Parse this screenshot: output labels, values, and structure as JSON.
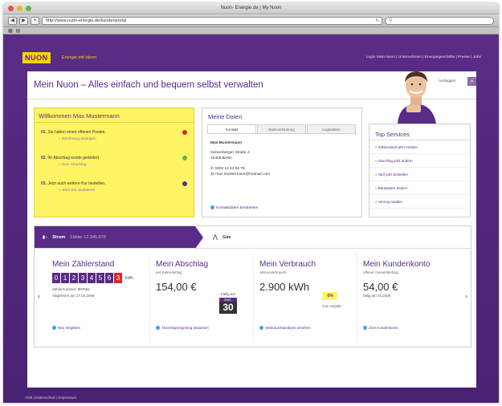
{
  "browser": {
    "window_title": "Nuon- Energie.de | My Nuon",
    "url": "http://www.nuon-energie.de/kundenportal",
    "search_placeholder": ""
  },
  "site": {
    "logo_text": "NUON",
    "tagline": "Energie mit Ideen",
    "nav_links": "Login Mein Nuon  |  Unternehmen  |  Energiegeschäfte  |  Presse  |  Jobs"
  },
  "header": {
    "title": "Mein Nuon – Alles einfach und bequem selbst verwalten",
    "logout_label": "Ausloggen",
    "logout_icon": "»"
  },
  "welcome": {
    "title": "Willkommen Max Mustermann",
    "tasks": [
      {
        "num": "01.",
        "text": "Sie haben einen offenen Posten.",
        "sub": "» Rechnung anzeigen",
        "status_color": "#e0242a"
      },
      {
        "num": "02.",
        "text": "Ihr Abschlag wurde geändert.",
        "sub": "» Zum Abschlag",
        "status_color": "#5fb84a"
      },
      {
        "num": "03.",
        "text": "Jetzt auch weitere Kur bestellen.",
        "sub": "» Jetzt Kur ausbauen",
        "status_color": "#5a2c87"
      }
    ]
  },
  "my_data": {
    "title": "Meine Daten",
    "tabs": [
      "Kontakt",
      "Bankverbindung",
      "Logindaten"
    ],
    "name": "Max Mustermann",
    "street": "Geisenberger Straße 4",
    "city": "10405 Berlin",
    "phone": "0303 12 34 56 78",
    "email": "max.mustermann@hotmail.com",
    "edit_link": "Kontaktdaten bearbeiten"
  },
  "services": {
    "title": "Top Services",
    "items": [
      "» Zählerstand jetzt melden",
      "» Abschlag jetzt ändern",
      "» Tarif jetzt bestellen",
      "» Bankdaten ändern",
      "» Umzug melden"
    ]
  },
  "meter_tabs": {
    "active_label": "Strom",
    "active_sub": "Zähler 12.345.678",
    "other_label": "Gas"
  },
  "meters": {
    "reading": {
      "title": "Mein Zählerstand",
      "digits": [
        "0",
        "1",
        "2",
        "3",
        "4",
        "5",
        "6"
      ],
      "last_digit": "3",
      "unit": "kWh",
      "meter_no": "Zählernummer: 987654",
      "reading_date": "Abgelesen am 17.04.2009",
      "link": "Neu eingeben"
    },
    "installment": {
      "title": "Mein Abschlag",
      "label": "per Kalendertag",
      "value": "154,00 €",
      "due_label": "Fällig am",
      "month": "Dez.",
      "day": "30",
      "link": "Abschlagsregelung anpassen"
    },
    "consumption": {
      "title": "Mein Verbrauch",
      "label": "Jahresverbrauch",
      "value": "2.900 kWh",
      "badge": "-5%",
      "note": "zum Vorjahr",
      "link": "Verbrauchsanalyse ansehen"
    },
    "account": {
      "title": "Mein Kundenkonto",
      "label": "offener Gesamtbetrag",
      "value": "54,00 €",
      "due": "fällig am 01.2009",
      "link": "Zum Kundenkonto"
    }
  },
  "footer": {
    "text": "AGB  |  Datenschutz  |  Impressum"
  }
}
